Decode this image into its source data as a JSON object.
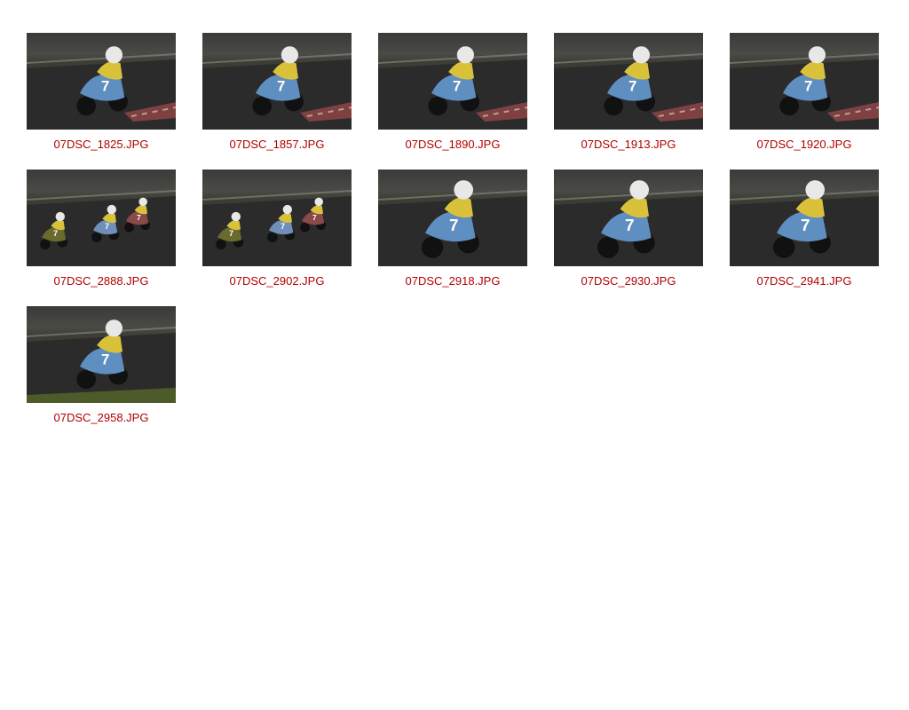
{
  "gallery": {
    "items": [
      {
        "filename": "07DSC_1825.JPG",
        "scene": "single-rider-curb"
      },
      {
        "filename": "07DSC_1857.JPG",
        "scene": "single-rider-curb"
      },
      {
        "filename": "07DSC_1890.JPG",
        "scene": "single-rider-curb"
      },
      {
        "filename": "07DSC_1913.JPG",
        "scene": "single-rider-curb"
      },
      {
        "filename": "07DSC_1920.JPG",
        "scene": "single-rider-curb"
      },
      {
        "filename": "07DSC_2888.JPG",
        "scene": "group-riders"
      },
      {
        "filename": "07DSC_2902.JPG",
        "scene": "group-riders"
      },
      {
        "filename": "07DSC_2918.JPG",
        "scene": "single-rider-close"
      },
      {
        "filename": "07DSC_2930.JPG",
        "scene": "single-rider-close"
      },
      {
        "filename": "07DSC_2941.JPG",
        "scene": "single-rider-close"
      },
      {
        "filename": "07DSC_2958.JPG",
        "scene": "single-rider-grass"
      }
    ]
  }
}
